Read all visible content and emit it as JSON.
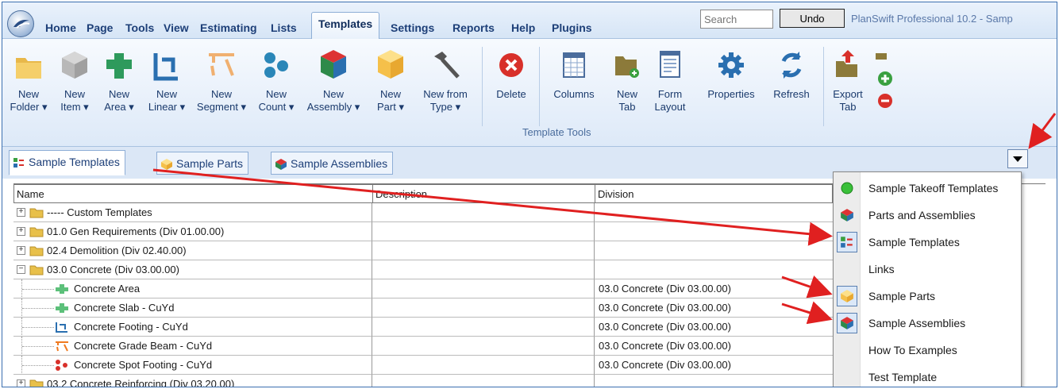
{
  "menubar": {
    "tabs": [
      "Home",
      "Page",
      "Tools",
      "View",
      "Estimating",
      "Lists",
      "Templates",
      "Settings",
      "Reports",
      "Help",
      "Plugins"
    ],
    "active_tab": "Templates",
    "search_placeholder": "Search",
    "undo_label": "Undo",
    "product_title": "PlanSwift Professional 10.2 - Samp"
  },
  "ribbon": {
    "group_label": "Template Tools",
    "buttons": [
      {
        "name": "new-folder",
        "line1": "New",
        "line2": "Folder ▾",
        "icon": "folder-icon"
      },
      {
        "name": "new-item",
        "line1": "New",
        "line2": "Item ▾",
        "icon": "cube-gray-icon"
      },
      {
        "name": "new-area",
        "line1": "New",
        "line2": "Area ▾",
        "icon": "area-icon"
      },
      {
        "name": "new-linear",
        "line1": "New",
        "line2": "Linear ▾",
        "icon": "linear-icon"
      },
      {
        "name": "new-segment",
        "line1": "New",
        "line2": "Segment ▾",
        "icon": "segment-icon"
      },
      {
        "name": "new-count",
        "line1": "New",
        "line2": "Count ▾",
        "icon": "count-icon"
      },
      {
        "name": "new-assembly",
        "line1": "New",
        "line2": "Assembly ▾",
        "icon": "assembly-icon"
      },
      {
        "name": "new-part",
        "line1": "New",
        "line2": "Part ▾",
        "icon": "part-icon"
      },
      {
        "name": "new-from-type",
        "line1": "New from",
        "line2": "Type ▾",
        "icon": "hammer-icon"
      },
      {
        "name": "delete",
        "line1": "Delete",
        "line2": "",
        "icon": "delete-icon"
      },
      {
        "name": "columns",
        "line1": "Columns",
        "line2": "",
        "icon": "columns-icon"
      },
      {
        "name": "new-tab",
        "line1": "New",
        "line2": "Tab",
        "icon": "new-tab-icon"
      },
      {
        "name": "form-layout",
        "line1": "Form",
        "line2": "Layout",
        "icon": "form-layout-icon"
      },
      {
        "name": "properties",
        "line1": "Properties",
        "line2": "",
        "icon": "gear-icon"
      },
      {
        "name": "refresh",
        "line1": "Refresh",
        "line2": "",
        "icon": "refresh-icon"
      },
      {
        "name": "export-tab",
        "line1": "Export",
        "line2": "Tab",
        "icon": "export-icon"
      }
    ]
  },
  "doc_tabs": [
    "Sample Templates",
    "Sample Parts",
    "Sample Assemblies"
  ],
  "grid": {
    "headers": [
      "Name",
      "Description",
      "Division"
    ],
    "rows": [
      {
        "name": "----- Custom Templates",
        "division": "",
        "level": 0,
        "expander": "+",
        "icon": "folder"
      },
      {
        "name": "01.0  Gen Requirements (Div 01.00.00)",
        "division": "",
        "level": 0,
        "expander": "+",
        "icon": "folder"
      },
      {
        "name": "02.4  Demolition (Div 02.40.00)",
        "division": "",
        "level": 0,
        "expander": "+",
        "icon": "folder"
      },
      {
        "name": "03.0  Concrete (Div 03.00.00)",
        "division": "",
        "level": 0,
        "expander": "−",
        "icon": "folder"
      },
      {
        "name": "Concrete Area",
        "division": "03.0  Concrete (Div 03.00.00)",
        "level": 1,
        "icon": "area"
      },
      {
        "name": "Concrete Slab - CuYd",
        "division": "03.0  Concrete (Div 03.00.00)",
        "level": 1,
        "icon": "area"
      },
      {
        "name": "Concrete Footing - CuYd",
        "division": "03.0  Concrete (Div 03.00.00)",
        "level": 1,
        "icon": "linear"
      },
      {
        "name": "Concrete Grade Beam - CuYd",
        "division": "03.0  Concrete (Div 03.00.00)",
        "level": 1,
        "icon": "segment"
      },
      {
        "name": "Concrete Spot Footing - CuYd",
        "division": "03.0  Concrete (Div 03.00.00)",
        "level": 1,
        "icon": "count"
      },
      {
        "name": "03.2  Concrete Reinforcing (Div 03.20.00)",
        "division": "",
        "level": 0,
        "expander": "+",
        "icon": "folder"
      }
    ]
  },
  "dropdown_menu": [
    {
      "label": "Sample Takeoff Templates",
      "icon": "green-dot-icon"
    },
    {
      "label": "Parts and Assemblies",
      "icon": "assembly-icon"
    },
    {
      "label": "Sample Templates",
      "icon": "templates-icon",
      "checked": true
    },
    {
      "label": "Links",
      "icon": ""
    },
    {
      "label": "Sample Parts",
      "icon": "part-icon",
      "checked": true
    },
    {
      "label": "Sample Assemblies",
      "icon": "assembly-icon",
      "checked": true
    },
    {
      "label": "How To Examples",
      "icon": ""
    },
    {
      "label": "Test Template",
      "icon": ""
    }
  ],
  "colors": {
    "accent": "#1d3f78",
    "annotation_arrow": "#e02020"
  }
}
